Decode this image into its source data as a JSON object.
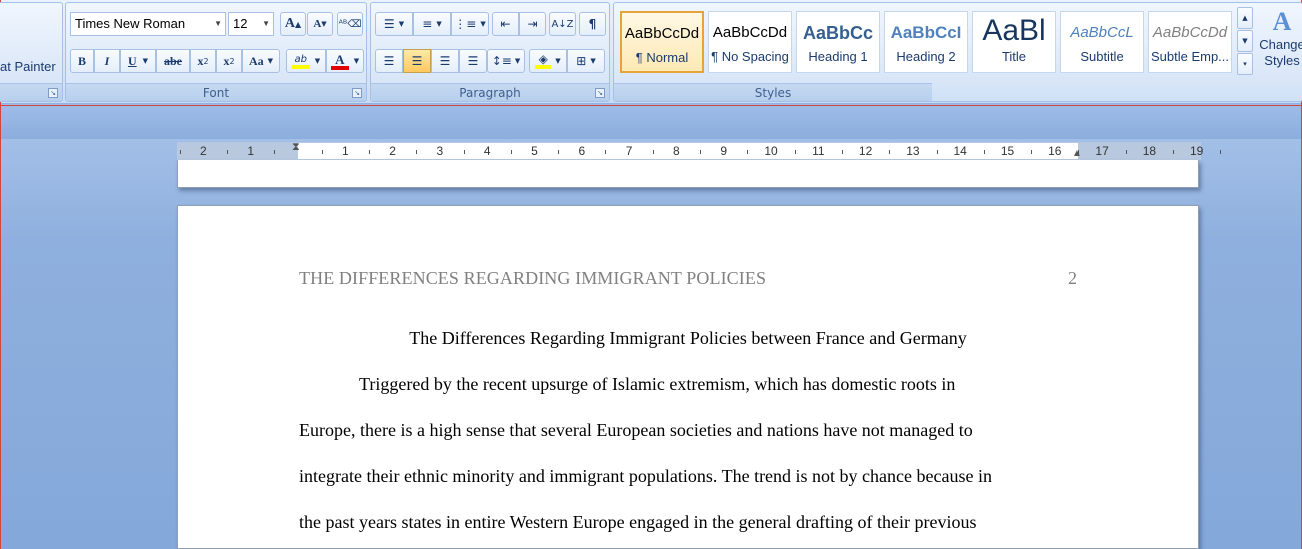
{
  "clipboard": {
    "format_painter_label": "at Painter"
  },
  "font": {
    "group_label": "Font",
    "font_name": "Times New Roman",
    "font_size": "12",
    "grow_label": "A",
    "shrink_label": "A",
    "bold_label": "B",
    "italic_label": "I",
    "underline_label": "U",
    "strike_label": "abe",
    "subscript_label": "x",
    "superscript_label": "x",
    "case_label": "Aa",
    "highlight_label": "ab",
    "font_color_label": "A"
  },
  "paragraph": {
    "group_label": "Paragraph"
  },
  "styles": {
    "group_label": "Styles",
    "change_styles_label": "Change Styles",
    "items": [
      {
        "sample": "AaBbCcDd",
        "name": "¶ Normal"
      },
      {
        "sample": "AaBbCcDd",
        "name": "¶ No Spacing"
      },
      {
        "sample": "AaBbCc",
        "name": "Heading 1"
      },
      {
        "sample": "AaBbCcI",
        "name": "Heading 2"
      },
      {
        "sample": "AaBl",
        "name": "Title"
      },
      {
        "sample": "AaBbCcL",
        "name": "Subtitle"
      },
      {
        "sample": "AaBbCcDd",
        "name": "Subtle Emp..."
      }
    ]
  },
  "ruler": {
    "numbers": [
      "2",
      "1",
      "1",
      "2",
      "3",
      "4",
      "5",
      "6",
      "7",
      "8",
      "9",
      "10",
      "11",
      "12",
      "13",
      "14",
      "15",
      "16",
      "17",
      "18",
      "19"
    ]
  },
  "document": {
    "header_title": "THE DIFFERENCES REGARDING IMMIGRANT POLICIES",
    "page_number": "2",
    "title": "The Differences Regarding Immigrant Policies between France and Germany",
    "lines": [
      "Triggered by the recent upsurge of Islamic extremism, which has domestic roots in",
      "Europe, there is a high sense that several European societies and nations have not managed to",
      "integrate their ethnic minority and immigrant populations. The trend is not by chance because in",
      "the past years states in entire Western Europe engaged in the general drafting of their previous"
    ]
  }
}
